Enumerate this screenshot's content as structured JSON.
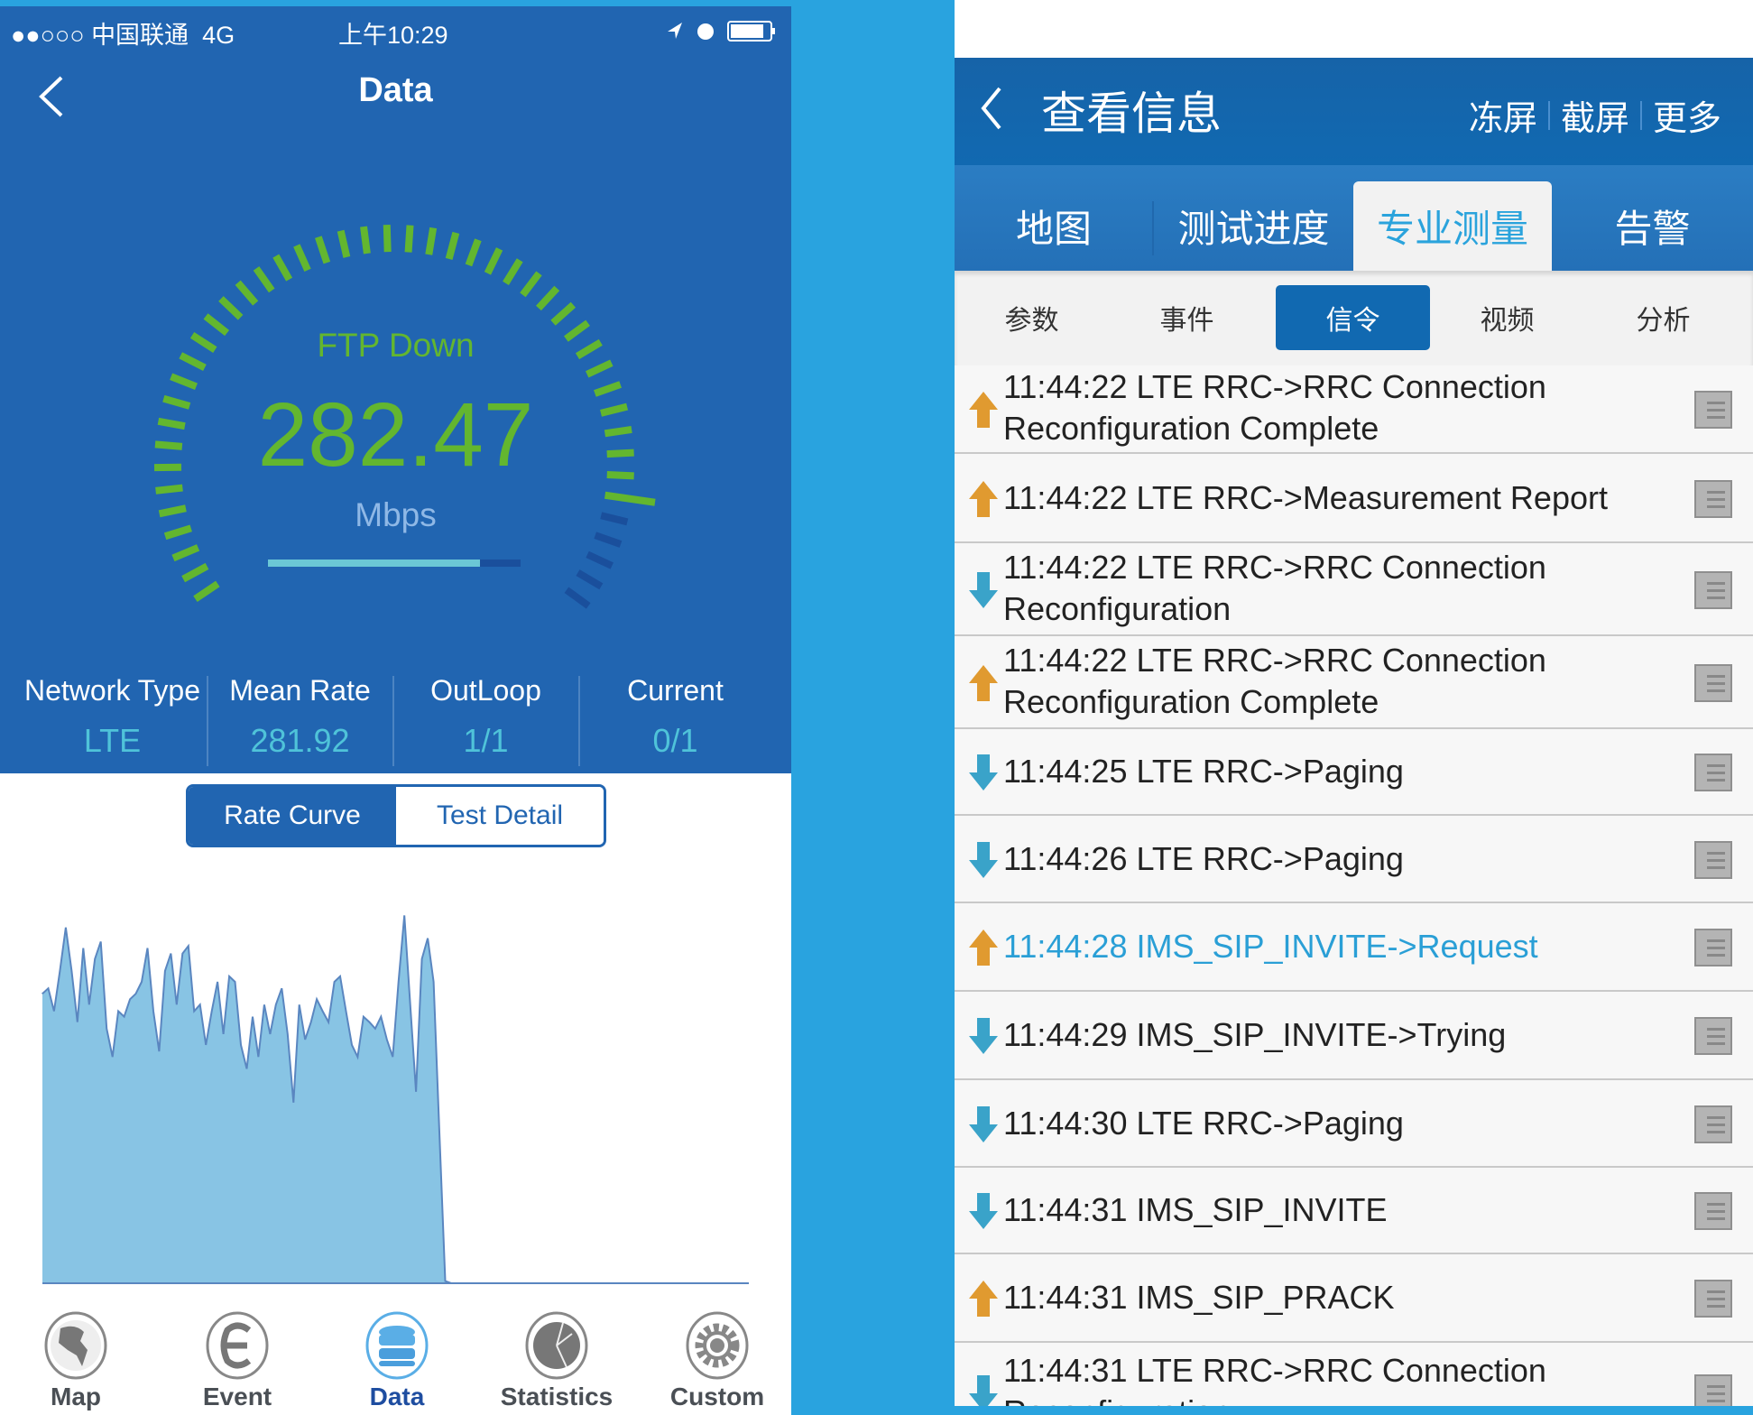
{
  "status_bar": {
    "signal": "●●○○○",
    "carrier": "中国联通",
    "network": "4G",
    "time": "上午10:29"
  },
  "left": {
    "title": "Data",
    "gauge": {
      "label": "FTP Down",
      "value": "282.47",
      "unit": "Mbps",
      "tick_level": 0.88,
      "progress_fraction": 0.84,
      "green": "#63b62f",
      "dim": "#1a4f9c"
    },
    "stats": [
      {
        "label": "Network Type",
        "value": "LTE"
      },
      {
        "label": "Mean Rate",
        "value": "281.92"
      },
      {
        "label": "OutLoop",
        "value": "1/1"
      },
      {
        "label": "Current",
        "value": "0/1"
      }
    ],
    "segments": [
      {
        "label": "Rate Curve",
        "selected": true
      },
      {
        "label": "Test Detail",
        "selected": false
      }
    ],
    "tabs": [
      {
        "label": "Map",
        "icon": "globe-icon"
      },
      {
        "label": "Event",
        "icon": "event-icon"
      },
      {
        "label": "Data",
        "icon": "database-icon",
        "active": true
      },
      {
        "label": "Statistics",
        "icon": "pie-chart-icon"
      },
      {
        "label": "Custom",
        "icon": "gear-icon"
      }
    ]
  },
  "chart_data": {
    "type": "area",
    "title": "",
    "xlabel": "",
    "ylabel": "",
    "ylim": [
      0,
      340
    ],
    "xlim": [
      0,
      121
    ],
    "grid": false,
    "fill": "#88c4e4",
    "stroke": "#5a86c0",
    "values": [
      266,
      271,
      250,
      287,
      327,
      287,
      240,
      308,
      256,
      298,
      314,
      234,
      208,
      250,
      245,
      261,
      266,
      277,
      308,
      250,
      213,
      287,
      303,
      256,
      303,
      310,
      250,
      256,
      219,
      250,
      277,
      229,
      282,
      277,
      219,
      197,
      245,
      208,
      256,
      229,
      256,
      271,
      229,
      166,
      256,
      224,
      240,
      261,
      250,
      240,
      277,
      282,
      250,
      219,
      208,
      245,
      240,
      234,
      245,
      224,
      208,
      277,
      338,
      256,
      176,
      298,
      317,
      277,
      139,
      2,
      0
    ]
  },
  "right": {
    "title": "查看信息",
    "actions": [
      "冻屏",
      "截屏",
      "更多"
    ],
    "tabs": [
      "地图",
      "测试进度",
      "专业测量",
      "告警"
    ],
    "selected_tab": 2,
    "subtabs": [
      "参数",
      "事件",
      "信令",
      "视频",
      "分析"
    ],
    "selected_subtab": 2,
    "colors": {
      "up": "#e09a30",
      "down": "#3aa3c9",
      "highlight": "#2a9fd6"
    },
    "messages": [
      {
        "dir": "up",
        "line1": "11:44:22 LTE RRC->RRC Connection",
        "line2": "Reconfiguration Complete"
      },
      {
        "dir": "up",
        "line1": "11:44:22 LTE RRC->Measurement Report"
      },
      {
        "dir": "down",
        "line1": "11:44:22 LTE RRC->RRC Connection",
        "line2": "Reconfiguration"
      },
      {
        "dir": "up",
        "line1": "11:44:22 LTE RRC->RRC Connection",
        "line2": "Reconfiguration Complete"
      },
      {
        "dir": "down",
        "line1": "11:44:25 LTE RRC->Paging"
      },
      {
        "dir": "down",
        "line1": "11:44:26 LTE RRC->Paging"
      },
      {
        "dir": "up",
        "line1": "11:44:28 IMS_SIP_INVITE->Request",
        "highlight": true
      },
      {
        "dir": "down",
        "line1": "11:44:29 IMS_SIP_INVITE->Trying"
      },
      {
        "dir": "down",
        "line1": "11:44:30 LTE RRC->Paging"
      },
      {
        "dir": "down",
        "line1": "11:44:31 IMS_SIP_INVITE"
      },
      {
        "dir": "up",
        "line1": "11:44:31 IMS_SIP_PRACK"
      },
      {
        "dir": "down",
        "line1": "11:44:31 LTE RRC->RRC Connection",
        "line2": "Reconfiguration"
      }
    ]
  }
}
